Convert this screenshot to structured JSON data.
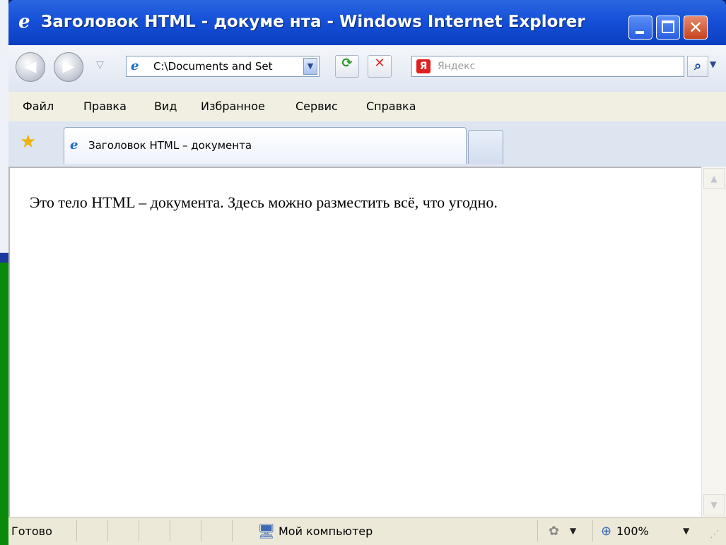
{
  "window": {
    "title": "Заголовок HTML - докуме нта - Windows Internet Explorer",
    "minimize_icon": "minimize-icon",
    "maximize_icon": "maximize-icon",
    "close_glyph": "✕",
    "accent": "#1550d8"
  },
  "navigation": {
    "back_glyph": "◀",
    "forward_glyph": "▶",
    "history_glyph": "▽",
    "address_value": "C:\\Documents and Set",
    "address_dropdown_glyph": "▼",
    "refresh_glyph": "⟳",
    "stop_glyph": "✕",
    "search_provider": "Я",
    "search_placeholder": "Яндекс",
    "search_go_glyph": "⌕",
    "search_dropdown_glyph": "▼"
  },
  "menu": {
    "items": [
      "Файл",
      "Правка",
      "Вид",
      "Избранное",
      "Сервис",
      "Справка"
    ]
  },
  "tabs": {
    "favorites_glyph": "★",
    "active_label": "Заголовок HTML – документа"
  },
  "page": {
    "body_text": "Это тело HTML – документа. Здесь можно разместить всё, что угодно."
  },
  "scrollbar": {
    "up_glyph": "▲",
    "down_glyph": "▼"
  },
  "status": {
    "text": "Готово",
    "zone_glyph": "🖥",
    "zone_label": "Мой компьютер",
    "protect_glyph": "✿",
    "protect_dropdown_glyph": "▼",
    "zoom_glyph": "⊕",
    "zoom_label": "100%",
    "zoom_dropdown_glyph": "▼",
    "grip_glyph": "⋰"
  }
}
